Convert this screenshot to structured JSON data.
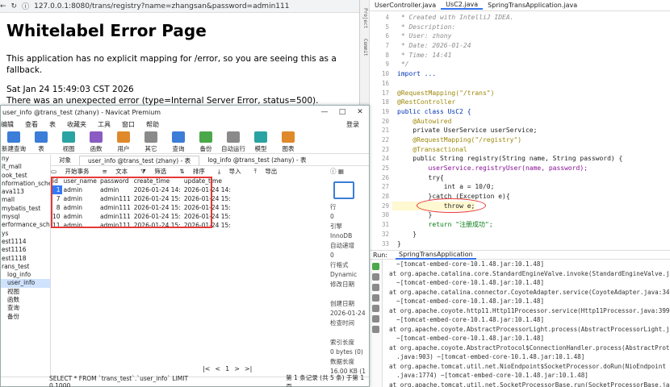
{
  "browser": {
    "url": "127.0.0.1:8080/trans/registry?name=zhangsan&password=admin111",
    "title": "Whitelabel Error Page",
    "line1": "This application has no explicit mapping for /error, so you are seeing this as a fallback.",
    "line2": "Sat Jan 24 15:49:03 CST 2026",
    "line3": "There was an unexpected error (type=Internal Server Error, status=500)."
  },
  "navicat": {
    "title": "user_info @trans_test (zhany) - Navicat Premium",
    "menu": [
      "编辑",
      "查看",
      "表",
      "收藏夹",
      "工具",
      "窗口",
      "帮助"
    ],
    "login": "登录",
    "toolbar": [
      "新建查询",
      "表",
      "视图",
      "函数",
      "用户",
      "其它",
      "查询",
      "备份",
      "自动运行",
      "模型",
      "图表"
    ],
    "sidebar": [
      "ny",
      "it_mall",
      "ook_test",
      "nformation_schema",
      "ava113",
      "mall",
      "mybatis_test",
      "mysql",
      "erformance_schema",
      "ys",
      "est1114",
      "est1116",
      "est1118",
      "rans_test",
      "log_info",
      "user_info",
      "视图",
      "函数",
      "查询",
      "备份"
    ],
    "tabs": [
      "对象",
      "user_info @trans_test (zhany) - 表",
      "log_info @trans_test (zhany) - 表"
    ],
    "subbar": [
      "开始事务",
      "文本",
      "筛选",
      "排序",
      "导入",
      "导出"
    ],
    "columns": [
      "id",
      "user_name",
      "password",
      "create_time",
      "update_time"
    ],
    "rows": [
      [
        "1",
        "admin",
        "admin",
        "2026-01-24 14:",
        "2026-01-24 14:"
      ],
      [
        "7",
        "admin",
        "admin111",
        "2026-01-24 15:",
        "2026-01-24 15:"
      ],
      [
        "8",
        "admin",
        "admin111",
        "2026-01-24 15:",
        "2026-01-24 15:"
      ],
      [
        "10",
        "admin",
        "admin111",
        "2026-01-24 15:",
        "2026-01-24 15:"
      ],
      [
        "11",
        "admin",
        "admin111",
        "2026-01-24 15:",
        "2026-01-24 15:"
      ]
    ],
    "info": [
      "行",
      "0",
      "引擎",
      "InnoDB",
      "自动递增",
      "0",
      "行格式",
      "Dynamic",
      "修改日期",
      "",
      "创建日期",
      "2026-01-24",
      "检查时间",
      "",
      "索引长度",
      "0 bytes (0)",
      "数据长度",
      "16.00 KB (1"
    ],
    "pager": [
      "|<",
      "<",
      "1",
      ">",
      ">|"
    ],
    "status_sql": "SELECT * FROM `trans_test`.`user_info` LIMIT 0,1000",
    "status_page": "第 1 条记录 (共 5 条) 于第 1 页"
  },
  "ide": {
    "tabs": [
      "UserController.java",
      "UsC2.java",
      "SpringTransApplication.java"
    ],
    "side_labels": [
      "Project",
      "Commit"
    ],
    "code": [
      {
        "n": "4",
        "t": " * Created with IntelliJ IDEA.",
        "c": "cmt"
      },
      {
        "n": "5",
        "t": " * Description:",
        "c": "cmt"
      },
      {
        "n": "6",
        "t": " * User: zhony",
        "c": "cmt"
      },
      {
        "n": "7",
        "t": " * Date: 2026-01-24",
        "c": "cmt"
      },
      {
        "n": "8",
        "t": " * Time: 14:41",
        "c": "cmt"
      },
      {
        "n": "9",
        "t": " */",
        "c": "cmt"
      },
      {
        "n": "10",
        "t": "import ...",
        "c": "kw"
      },
      {
        "n": "16",
        "t": "",
        "c": ""
      },
      {
        "n": "17",
        "t": "@RequestMapping(\"/trans\")",
        "c": "ann"
      },
      {
        "n": "18",
        "t": "@RestController",
        "c": "ann"
      },
      {
        "n": "19",
        "t": "public class UsC2 {",
        "c": "kw"
      },
      {
        "n": "20",
        "t": "    @Autowired",
        "c": "ann"
      },
      {
        "n": "21",
        "t": "    private UserService userService;",
        "c": ""
      },
      {
        "n": "22",
        "t": "    @RequestMapping(\"/registry\")",
        "c": "ann"
      },
      {
        "n": "23",
        "t": "    @Transactional",
        "c": "ann"
      },
      {
        "n": "24",
        "t": "    public String registry(String name, String password) {",
        "c": ""
      },
      {
        "n": "25",
        "t": "        userService.registryUser(name, password);",
        "c": "fld"
      },
      {
        "n": "26",
        "t": "        try{",
        "c": ""
      },
      {
        "n": "27",
        "t": "            int a = 10/0;",
        "c": ""
      },
      {
        "n": "28",
        "t": "        }catch (Exception e){",
        "c": ""
      },
      {
        "n": "29",
        "t": "            throw e;",
        "c": "hl"
      },
      {
        "n": "30",
        "t": "        }",
        "c": ""
      },
      {
        "n": "31",
        "t": "        return \"注册成功\";",
        "c": "str"
      },
      {
        "n": "32",
        "t": "    }",
        "c": ""
      },
      {
        "n": "33",
        "t": "}",
        "c": ""
      }
    ],
    "run_label": "Run:",
    "run_tab": "SpringTransApplication",
    "console": [
      "  ~[tomcat-embed-core-10.1.48.jar:10.1.48]",
      "at org.apache.catalina.core.StandardEngineValve.invoke(StandardEngineValve.ja",
      "  ~[tomcat-embed-core-10.1.48.jar:10.1.48]",
      "at org.apache.catalina.connector.CoyoteAdapter.service(CoyoteAdapter.java:342",
      "  ~[tomcat-embed-core-10.1.48.jar:10.1.48]",
      "at org.apache.coyote.http11.Http11Processor.service(Http11Processor.java:399)",
      "  ~[tomcat-embed-core-10.1.48.jar:10.1.48]",
      "at org.apache.coyote.AbstractProcessorLight.process(AbstractProcessorLight.ja",
      "  ~[tomcat-embed-core-10.1.48.jar:10.1.48]",
      "at org.apache.coyote.AbstractProtocol$ConnectionHandler.process(AbstractProto",
      "  .java:903) ~[tomcat-embed-core-10.1.48.jar:10.1.48]",
      "at org.apache.tomcat.util.net.NioEndpoint$SocketProcessor.doRun(NioEndpoint",
      "  .java:1774) ~[tomcat-embed-core-10.1.48.jar:10.1.48]",
      "at org.apache.tomcat.util.net.SocketProcessorBase.run(SocketProcessorBase.ja"
    ]
  }
}
